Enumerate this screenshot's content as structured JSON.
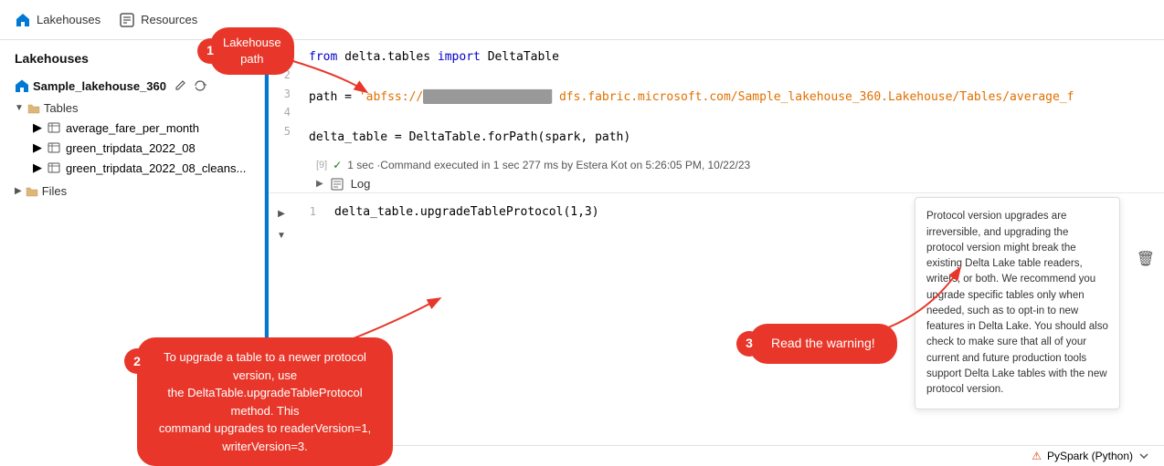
{
  "nav": {
    "lakehouses_label": "Lakehouses",
    "resources_label": "Resources"
  },
  "sidebar": {
    "title": "Lakehouses",
    "lakehouse_name": "Sample_lakehouse_360",
    "sections": [
      {
        "name": "Tables",
        "items": [
          "average_fare_per_month",
          "green_tripdata_2022_08",
          "green_tripdata_2022_08_cleans..."
        ]
      },
      {
        "name": "Files",
        "items": []
      }
    ]
  },
  "code_cell_1": {
    "lines": [
      {
        "num": "1",
        "content": "from delta.tables import DeltaTable"
      },
      {
        "num": "2",
        "content": ""
      },
      {
        "num": "3",
        "content": "path = 'abfss://██████████████████ dfs.fabric.microsoft.com/Sample_lakehouse_360.Lakehouse/Tables/average_f"
      },
      {
        "num": "4",
        "content": ""
      },
      {
        "num": "5",
        "content": "delta_table = DeltaTable.forPath(spark, path)"
      }
    ],
    "output": "[9]",
    "output_text": "1 sec ·Command executed in 1 sec 277 ms by Estera Kot on 5:26:05 PM, 10/22/23",
    "log_label": "Log"
  },
  "code_cell_2": {
    "line_num": "1",
    "content": "delta_table.upgradeTableProtocol(1,3)"
  },
  "warning_popup": {
    "text": "Protocol version upgrades are irreversible, and upgrading the protocol version might break the existing Delta Lake table readers, writers, or both. We recommend you upgrade specific tables only when needed, such as to opt-in to new features in Delta Lake. You should also check to make sure that all of your current and future production tools support Delta Lake tables with the new protocol version."
  },
  "pyspark_label": "PySpark (Python)",
  "callouts": {
    "one": {
      "number": "1",
      "text": "Lakehouse\npath"
    },
    "two": {
      "number": "2",
      "text": "To upgrade a table to a newer protocol version, use\nthe DeltaTable.upgradeTableProtocol method. This\ncommand upgrades to readerVersion=1,\nwriterVersion=3."
    },
    "three": {
      "number": "3",
      "text": "Read the warning!"
    }
  }
}
